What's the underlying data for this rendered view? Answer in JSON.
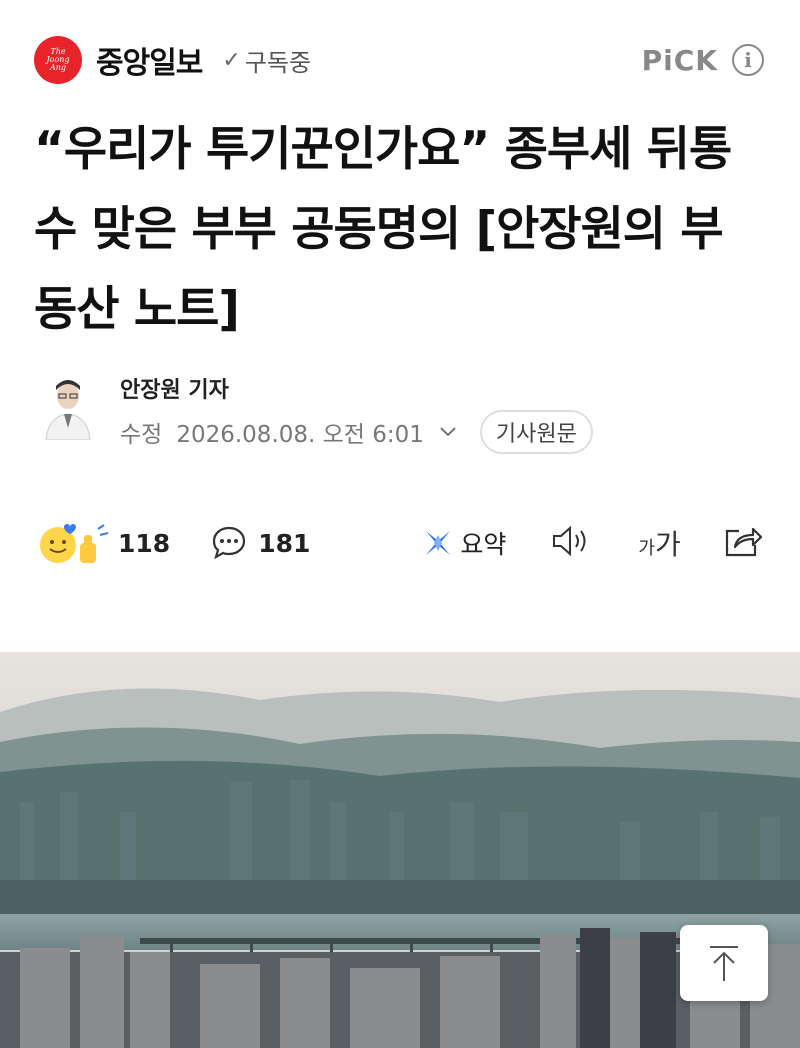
{
  "header": {
    "logo_lines": [
      "The",
      "Joong",
      "Ang"
    ],
    "press_name": "중앙일보",
    "subscribe_label": "구독중",
    "pick_label": "PiCK",
    "info_icon": "i"
  },
  "article": {
    "title": "“우리가 투기꾼인가요” 종부세 뒤통수 맞은 부부 공동명의 [안장원의 부동산 노트]",
    "author": "안장원 기자",
    "date_label": "수정",
    "date": "2026.08.08. 오전 6:01",
    "original_button": "기사원문"
  },
  "actions": {
    "reaction_count": "118",
    "comment_count": "181",
    "summary_label": "요약",
    "font_small": "가",
    "font_big": "가"
  },
  "colors": {
    "brand": "#e8242a",
    "summary_accent": "#2a6df4"
  }
}
